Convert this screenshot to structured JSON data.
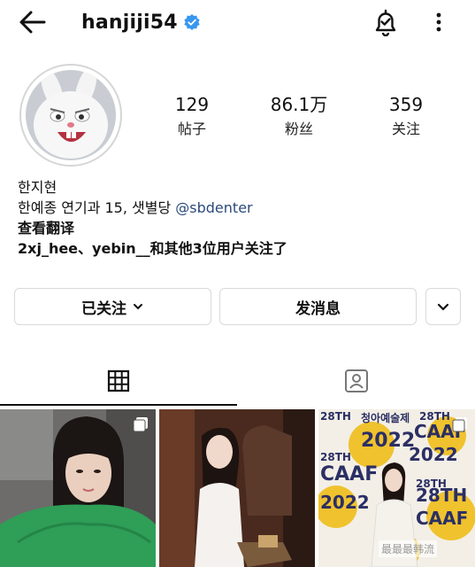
{
  "header": {
    "username": "hanjiji54",
    "back_icon": "arrow-left",
    "bell_icon": "bell-check",
    "more_icon": "more-vertical"
  },
  "stats": {
    "posts_count": "129",
    "posts_label": "帖子",
    "followers_count": "86.1万",
    "followers_label": "粉丝",
    "following_count": "359",
    "following_label": "关注"
  },
  "bio": {
    "name": "한지현",
    "line": "한예종 연기과 15, 샛별당 ",
    "mention": "@sbdenter",
    "translate": "查看翻译",
    "followed_by": "2xj_hee、yebin__和其他3位用户关注了"
  },
  "buttons": {
    "following_label": "已关注",
    "message_label": "发消息"
  },
  "photos": {
    "p3_lines": [
      "28TH",
      "청아예술제",
      "2022",
      "28TH",
      "CAAF",
      "2022",
      "28TH",
      "CAAF",
      "28TH",
      "2022",
      "28TH",
      "CAAF"
    ]
  },
  "watermark": "最最最韩流",
  "colors": {
    "verified": "#3897f0",
    "link": "#2b4a7a",
    "poster_yellow": "#f0c22e"
  }
}
